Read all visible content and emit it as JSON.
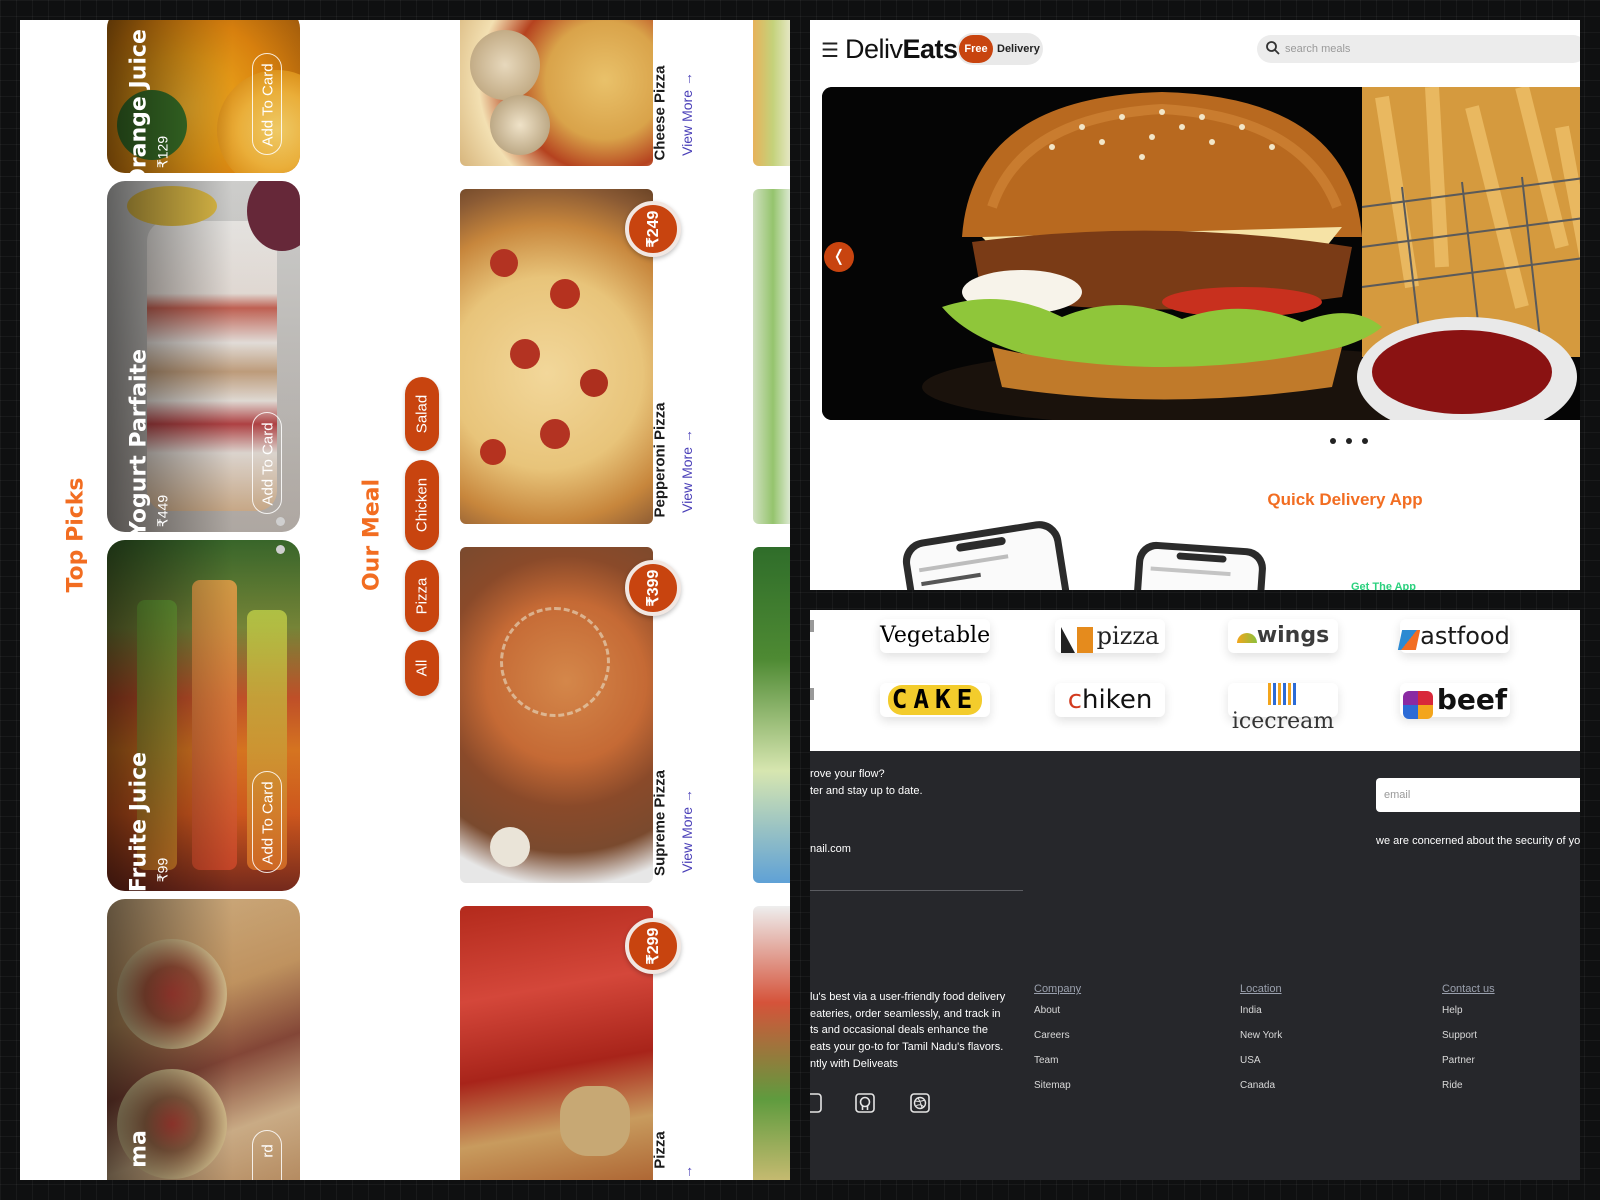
{
  "left_panel": {
    "top_picks_title": "Top Picks",
    "our_meal_title": "Our Meal",
    "top_picks": [
      {
        "name": "Orange Juice",
        "price": "₹129",
        "button": "Add To Card"
      },
      {
        "name": "Yogurt Parfaite",
        "price": "₹449",
        "button": "Add To Card"
      },
      {
        "name": "Fruite Juice",
        "price": "₹99",
        "button": "Add To Card"
      },
      {
        "name": "ma",
        "price": "",
        "button": "rd"
      }
    ],
    "filters": [
      "Salad",
      "Chicken",
      "Pizza",
      "All"
    ],
    "meals": [
      {
        "name": "Cheese Pizza",
        "price": "",
        "view_more": "View More"
      },
      {
        "name": "Pepperoni Pizza",
        "price": "₹249",
        "view_more": "View More"
      },
      {
        "name": "Supreme Pizza",
        "price": "₹399",
        "view_more": "View More"
      },
      {
        "name": "Pizza",
        "price": "₹299",
        "view_more": ""
      }
    ],
    "arrow_icon": "arrow-right-icon"
  },
  "header": {
    "menu_icon": "☰",
    "logo_light": "Deliv",
    "logo_bold": "Eats",
    "free_label": "Free",
    "delivery_label": "Delivery",
    "search_placeholder": "search meals",
    "search_icon": "search-icon"
  },
  "hero": {
    "prev_icon": "❬",
    "dots_count": 3
  },
  "app_section": {
    "title": "Quick Delivery App",
    "get_app": "Get The App"
  },
  "brands": [
    {
      "name": "Vegetable",
      "color": "#111111"
    },
    {
      "name": "pizza",
      "color": "#222222"
    },
    {
      "name": "wings",
      "color": "#3c3c3c"
    },
    {
      "name": "astfood",
      "color": "#1a1a1a"
    },
    {
      "name": "CAKE",
      "color": "#111111"
    },
    {
      "name": "hiken",
      "color": "#111111"
    },
    {
      "name": "icecream",
      "color": "#333333"
    },
    {
      "name": "beef",
      "color": "#111111"
    }
  ],
  "footer": {
    "newsletter_line1": "rove your flow?",
    "newsletter_line2": "ter and stay up to date.",
    "email_partial": "nail.com",
    "email_placeholder": "email",
    "security_note": "we are concerned about the security of yo",
    "about_lines": [
      "lu's best via a user-friendly food delivery",
      "eateries, order seamlessly, and track in",
      "ts and occasional deals enhance the",
      "eats your go-to for Tamil Nadu's flavors.",
      "ntly with Deliveats"
    ],
    "columns": [
      {
        "heading": "Company",
        "items": [
          "About",
          "Careers",
          "Team",
          "Sitemap"
        ]
      },
      {
        "heading": "Location",
        "items": [
          "India",
          "New York",
          "USA",
          "Canada"
        ]
      },
      {
        "heading": "Contact us",
        "items": [
          "Help",
          "Support",
          "Partner",
          "Ride"
        ]
      }
    ],
    "social_icons": [
      "twitter-icon",
      "github-icon",
      "dribbble-icon"
    ]
  },
  "colors": {
    "accent": "#c8440f",
    "orange_title": "#f26d21",
    "view_more": "#4a3fb8",
    "footer_bg": "#26272b"
  }
}
